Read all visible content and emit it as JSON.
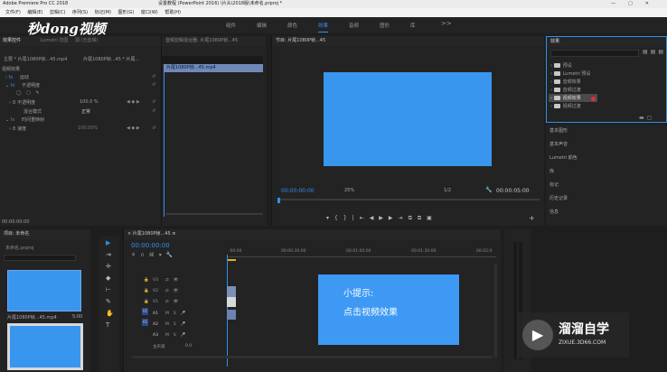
{
  "window": {
    "title_left": "Adobe Premiere Pro CC 2018",
    "title_right": "设置教程 (PowerPoint 2016) \\片头\\2018版\\未命名.prproj *"
  },
  "menu": [
    "文件(F)",
    "编辑(E)",
    "剪辑(C)",
    "序列(S)",
    "标记(M)",
    "图形(G)",
    "窗口(W)",
    "帮助(H)"
  ],
  "workspaces": [
    "组件",
    "编辑",
    "颜色",
    "效果",
    "音频",
    "图形",
    "库",
    ">>"
  ],
  "workspace_active": "效果",
  "logo": {
    "text": "秒dong视频"
  },
  "effect_controls": {
    "tabs": [
      "效果控件",
      "Lumetri 范围",
      "源:(无剪辑)"
    ],
    "source_row": "主要 * 片尾1080P帧...45.mp4",
    "clip_row": "片尾1080P帧...45 * 片尾...",
    "section_video": "视频效果",
    "motion": "运动",
    "opacity": "不透明度",
    "opacity_label": "不透明度",
    "opacity_value": "100.0 %",
    "blend_label": "混合模式",
    "blend_value": "正常",
    "time_remap": "时间重映射",
    "speed_label": "速度",
    "speed_value": "100.00%",
    "timecode": "00:00:00:00",
    "clip_bar_label": "片尾1080P帧...45.mp4"
  },
  "mixer": {
    "header": "音频剪辑混合器: 片尾1080P帧...45"
  },
  "program_monitor": {
    "header": "节目: 片尾1080P帧...45",
    "timecode": "00:00:00:00",
    "zoom": "25%",
    "ratio": "1/2",
    "duration": "00:00:05:00"
  },
  "effects_panel": {
    "title": "效果",
    "items": [
      "预设",
      "Lumetri 预设",
      "音频效果",
      "音频过渡",
      "视频效果",
      "视频过渡"
    ],
    "highlighted": "视频效果"
  },
  "right_list": [
    "基本图形",
    "基本声音",
    "Lumetri 颜色",
    "库",
    "标记",
    "历史记录",
    "信息"
  ],
  "project": {
    "title": "项目: 未命名",
    "file": "未命名.prproj",
    "clip_name": "片尾1080P帧...45.mp4",
    "clip_duration": "5:00"
  },
  "timeline": {
    "title": "片尾1080P帧...45",
    "timecode": "00:00:00:00",
    "ruler": [
      ":00:00",
      "00:00:30:00",
      "00:01:00:00",
      "00:01:30:00",
      "00:02:0"
    ],
    "video_tracks": [
      "V3",
      "V2",
      "V1"
    ],
    "audio_tracks": [
      "A1",
      "A2",
      "A3"
    ],
    "master_label": "主声道",
    "master_value": "0.0"
  },
  "tip": {
    "line1": "小提示:",
    "line2": "点击视频效果"
  },
  "watermark": {
    "brand": "溜溜自学",
    "url": "ZIXUE.3D66.COM"
  },
  "colors": {
    "accent": "#2e8ff0",
    "monitor": "#3996ef",
    "tip_bg": "#3d99f3"
  }
}
